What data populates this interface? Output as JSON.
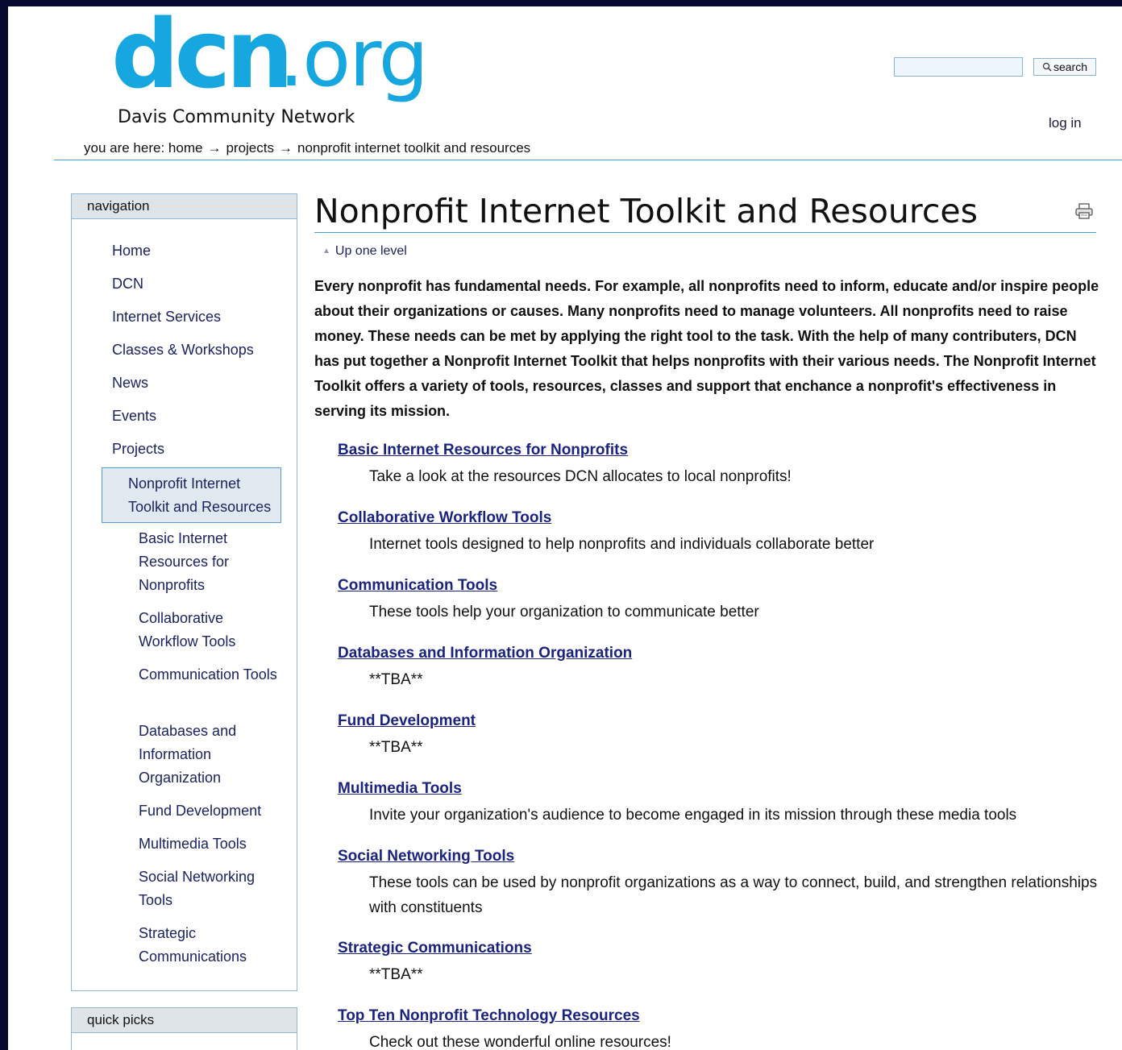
{
  "header": {
    "logo_main": "dcn",
    "logo_ext": ".org",
    "logo_sub": "Davis Community Network",
    "search_placeholder": "",
    "search_button": "search",
    "login": "log in"
  },
  "breadcrumb": {
    "prefix": "you are here:",
    "items": [
      "home",
      "projects",
      "nonprofit internet toolkit and resources"
    ],
    "arrow": "→"
  },
  "sidebar": {
    "nav_title": "navigation",
    "top_items": [
      "Home",
      "DCN",
      "Internet Services",
      "Classes & Workshops",
      "News",
      "Events",
      "Projects"
    ],
    "current": "Nonprofit Internet Toolkit and Resources",
    "sub_items": [
      "Basic Internet Resources for Nonprofits",
      "Collaborative Workflow Tools",
      "Communication Tools",
      "Databases and Information Organization",
      "Fund Development",
      "Multimedia Tools",
      "Social Networking Tools",
      "Strategic Communications"
    ],
    "quick_title": "quick picks"
  },
  "main": {
    "title": "Nonprofit Internet Toolkit and Resources",
    "up_level": "Up one level",
    "lead": "Every nonprofit has fundamental needs. For example, all nonprofits need to inform, educate and/or inspire people about their organizations or causes. Many nonprofits need to manage volunteers. All nonprofits need to raise money. These needs can be met by applying the right tool to the task. With the help of many contributers, DCN has put together a Nonprofit Internet Toolkit that helps nonprofits with their various needs. The Nonprofit Internet Toolkit offers a variety of tools, resources, classes and support that enchance a nonprofit's effectiveness in serving its mission.",
    "entries": [
      {
        "title": "Basic Internet Resources for Nonprofits",
        "desc": "Take a look at the resources DCN allocates to local nonprofits!"
      },
      {
        "title": "Collaborative Workflow Tools",
        "desc": "Internet tools designed to help nonprofits and individuals collaborate better"
      },
      {
        "title": "Communication Tools",
        "desc": "These tools help your organization to communicate better"
      },
      {
        "title": "Databases and Information Organization",
        "desc": "**TBA**"
      },
      {
        "title": "Fund Development",
        "desc": "**TBA**"
      },
      {
        "title": "Multimedia Tools",
        "desc": "Invite your organization's audience to become engaged in its mission through these media tools"
      },
      {
        "title": "Social Networking Tools",
        "desc": "These tools can be used by nonprofit organizations as a way to connect, build, and strengthen relationships with constituents"
      },
      {
        "title": "Strategic Communications",
        "desc": "**TBA**"
      },
      {
        "title": "Top Ten Nonprofit Technology Resources",
        "desc": "Check out these wonderful online resources!"
      }
    ]
  },
  "icons": {
    "print": "printer-icon",
    "search": "magnifier-icon"
  },
  "colors": {
    "logo": "#16a6e0",
    "link": "#1a237e",
    "border": "#8fb8d8",
    "page_bg": "#050a2e"
  }
}
